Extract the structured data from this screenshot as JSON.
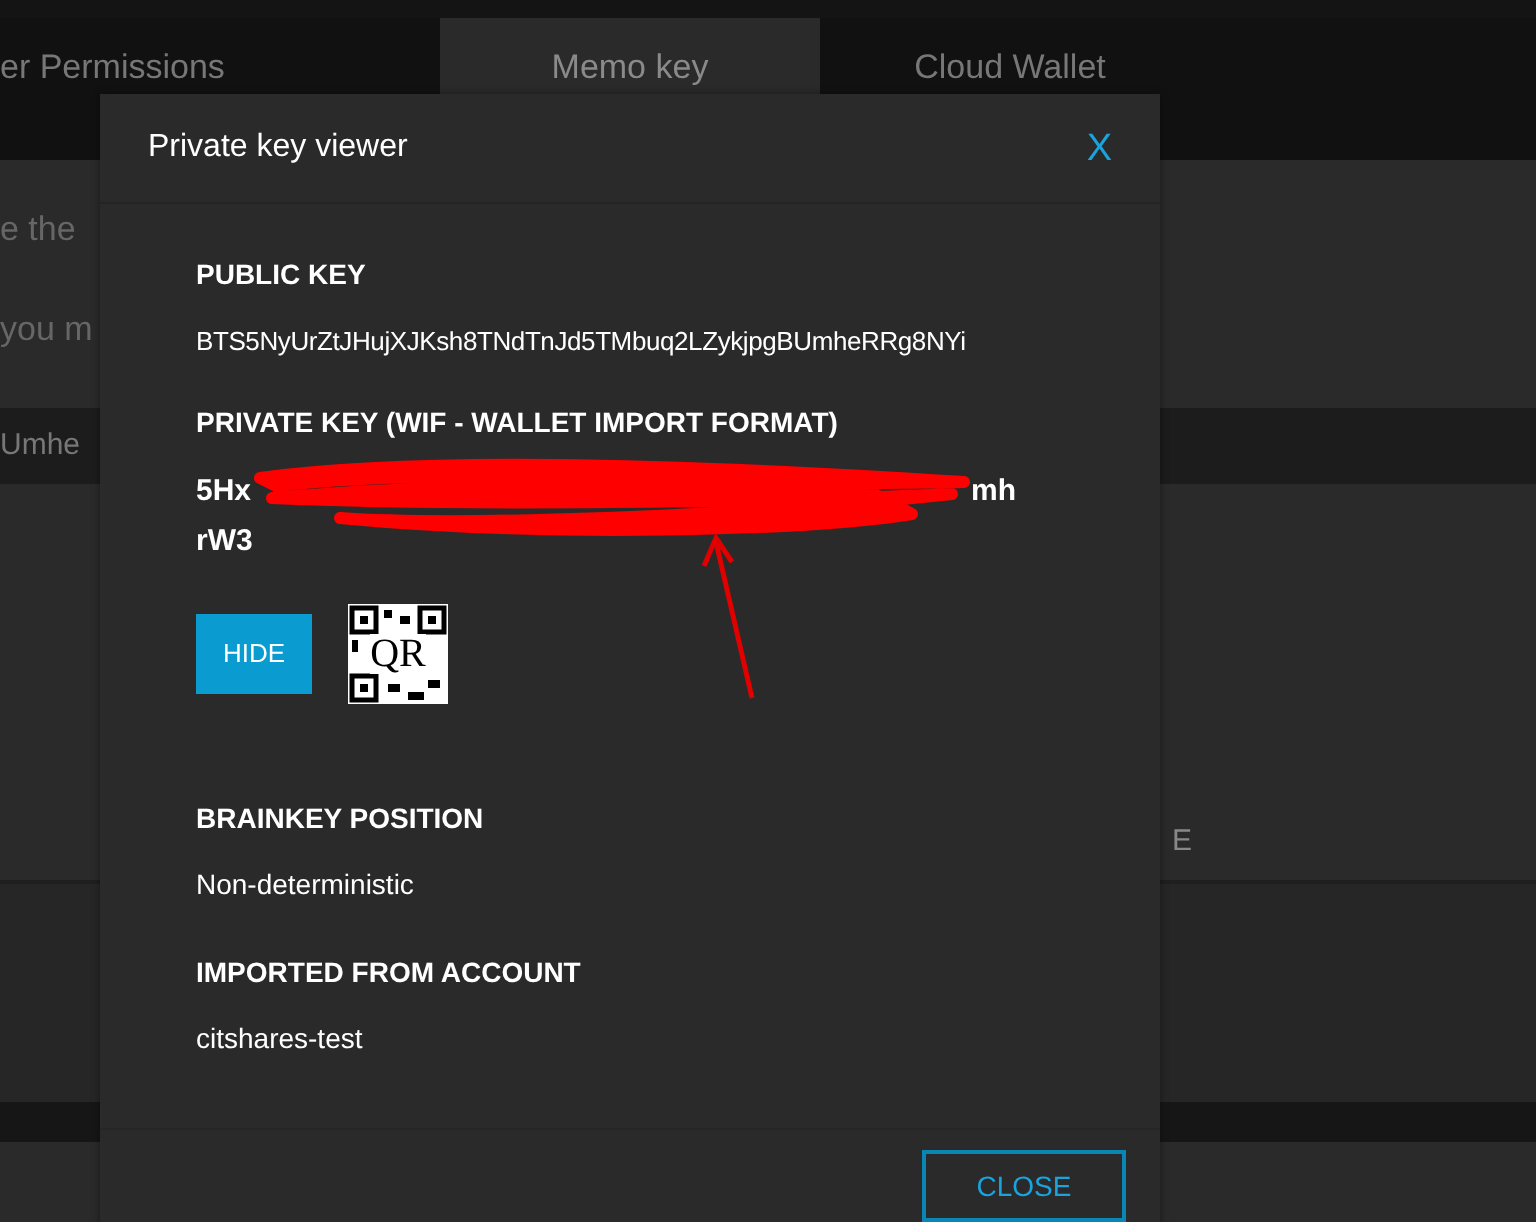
{
  "tabs": [
    {
      "label": "er Permissions",
      "selected": false
    },
    {
      "label": "Memo key",
      "selected": true
    },
    {
      "label": "Cloud Wallet",
      "selected": false
    }
  ],
  "background": {
    "line_1": "e the",
    "line_2": "you m",
    "band_text": "Umhe",
    "right_text": "E"
  },
  "dialog": {
    "title": "Private key viewer",
    "close_symbol": "X",
    "public_key": {
      "label": "PUBLIC KEY",
      "value": "BTS5NyUrZtJHujXJKsh8TNdTnJd5TMbuq2LZykjpgBUmheRRg8NYi"
    },
    "private_key": {
      "label": "PRIVATE KEY (WIF - WALLET IMPORT FORMAT)",
      "visible_start": "5Hx",
      "visible_end": "mh",
      "line_2": "rW3"
    },
    "hide_button": "HIDE",
    "qr_label": "QR",
    "brainkey": {
      "label": "BRAINKEY POSITION",
      "value": "Non-deterministic"
    },
    "imported": {
      "label": "IMPORTED FROM ACCOUNT",
      "value": "citshares-test"
    },
    "close_button": "CLOSE"
  }
}
